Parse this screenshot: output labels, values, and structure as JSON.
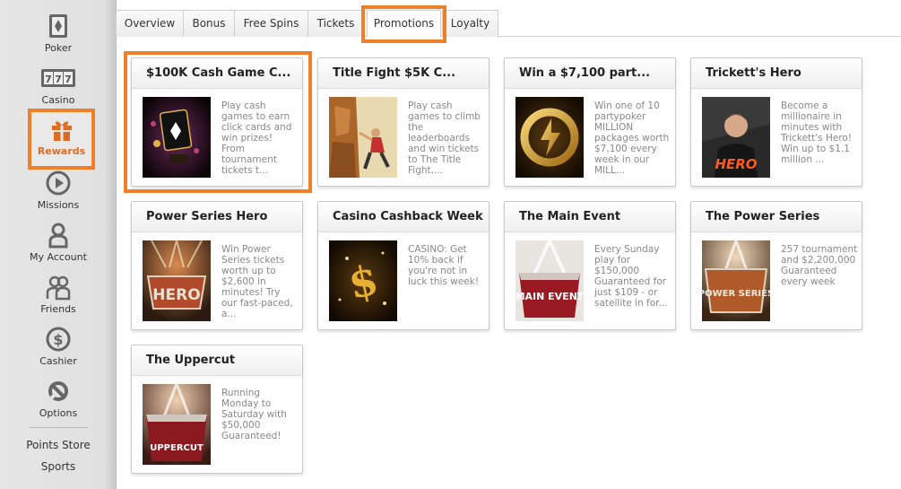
{
  "sidebar": {
    "items": [
      {
        "label": "Poker",
        "icon": "poker-card-icon"
      },
      {
        "label": "Casino",
        "icon": "slot-777-icon"
      },
      {
        "label": "Rewards",
        "icon": "gift-icon"
      },
      {
        "label": "Missions",
        "icon": "play-circle-icon"
      },
      {
        "label": "My Account",
        "icon": "user-icon"
      },
      {
        "label": "Friends",
        "icon": "friends-icon"
      },
      {
        "label": "Cashier",
        "icon": "dollar-icon"
      },
      {
        "label": "Options",
        "icon": "wrench-icon"
      }
    ],
    "links": [
      "Points Store",
      "Sports"
    ],
    "accent": "#f07f2a"
  },
  "tabs": [
    "Overview",
    "Bonus",
    "Free Spins",
    "Tickets",
    "Promotions",
    "Loyalty"
  ],
  "active_tab": "Promotions",
  "cards": [
    {
      "title": "$100K Cash Game C...",
      "desc": "Play cash games to earn click cards and win prizes! From tournament tickets t..."
    },
    {
      "title": "Title Fight $5K C...",
      "desc": "Play cash games to climb the leaderboards and win tickets to The Title Fight,..."
    },
    {
      "title": "Win a $7,100 part...",
      "desc": "Win one of 10 partypoker MILLION packages worth $7,100 every week in our MILL..."
    },
    {
      "title": "Trickett's Hero",
      "desc": "Become a millionaire in minutes with Trickett's Hero! Win up to $1.1 million ..."
    },
    {
      "title": "Power Series Hero",
      "desc": "Win Power Series tickets worth up to $2,600 in minutes! Try our fast-paced, a..."
    },
    {
      "title": "Casino Cashback Week",
      "desc": "CASINO: Get 10% back if you're not in luck this week!"
    },
    {
      "title": "The Main Event",
      "desc": "Every Sunday play for $150,000 Guaranteed for just $109 - or satellite in for..."
    },
    {
      "title": "The Power Series",
      "desc": "257 tournament and $2,200,000 Guaranteed every week"
    },
    {
      "title": "The Uppercut",
      "desc": "Running Monday to Saturday with $50,000 Guaranteed!"
    }
  ],
  "image_text": {
    "hero": "HERO",
    "power_hero": "HERO",
    "main_event": "MAIN EVENT",
    "power_series": "POWER SERIES",
    "uppercut": "UPPERCUT"
  }
}
